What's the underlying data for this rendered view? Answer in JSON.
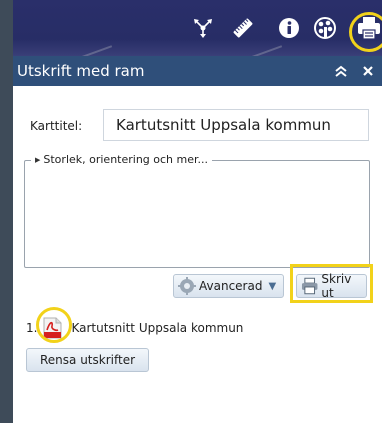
{
  "panel": {
    "title": "Utskrift med ram"
  },
  "form": {
    "map_title_label": "Karttitel:",
    "map_title_value": "Kartutsnitt Uppsala kommun",
    "options_legend": "Storlek, orientering och mer..."
  },
  "buttons": {
    "advanced": "Avancerad",
    "print": "Skriv ut",
    "clear": "Rensa utskrifter"
  },
  "results": [
    {
      "index": "1.",
      "label": "Kartutsnitt Uppsala kommun"
    }
  ],
  "toolbar": {
    "icons": [
      "move-icon",
      "ruler-icon",
      "info-icon",
      "palette-icon",
      "printer-icon"
    ]
  },
  "colors": {
    "toolbar_bg": "#2a2f6a",
    "panel_header_bg": "#2f4f7a",
    "highlight": "#f2d21a",
    "pdf_red": "#d6201f"
  }
}
